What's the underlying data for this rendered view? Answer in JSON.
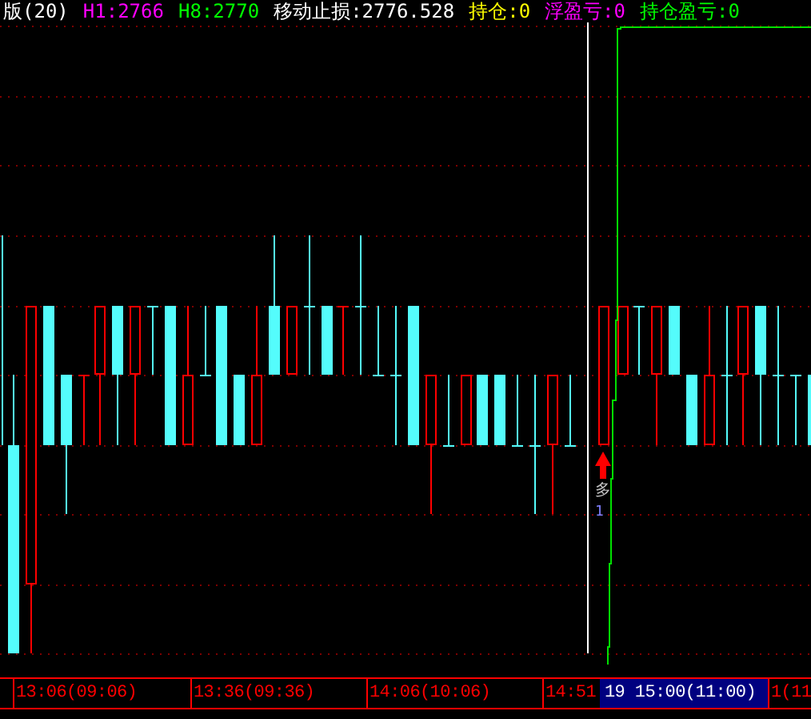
{
  "header": [
    {
      "text": "版(20)",
      "color": "#ffffff"
    },
    {
      "text": "H1:2766",
      "color": "#ff00ff"
    },
    {
      "text": "H8:2770",
      "color": "#00ff00"
    },
    {
      "text": "移动止损:2776.528",
      "color": "#ffffff"
    },
    {
      "text": "持仓:0",
      "color": "#ffff00"
    },
    {
      "text": "浮盈亏:0",
      "color": "#ff00ff"
    },
    {
      "text": "持仓盈亏:0",
      "color": "#00ff00"
    }
  ],
  "chart": {
    "signal_label": "多",
    "signal_count": "1"
  },
  "time_axis": [
    {
      "label": "13:06(09:06)",
      "selected": false
    },
    {
      "label": "13:36(09:36)",
      "selected": false
    },
    {
      "label": "14:06(10:06)",
      "selected": false
    },
    {
      "label": "14:51",
      "selected": false
    },
    {
      "label": "19 15:00(11:00)",
      "selected": true
    },
    {
      "label": "1(11",
      "selected": false
    }
  ]
}
